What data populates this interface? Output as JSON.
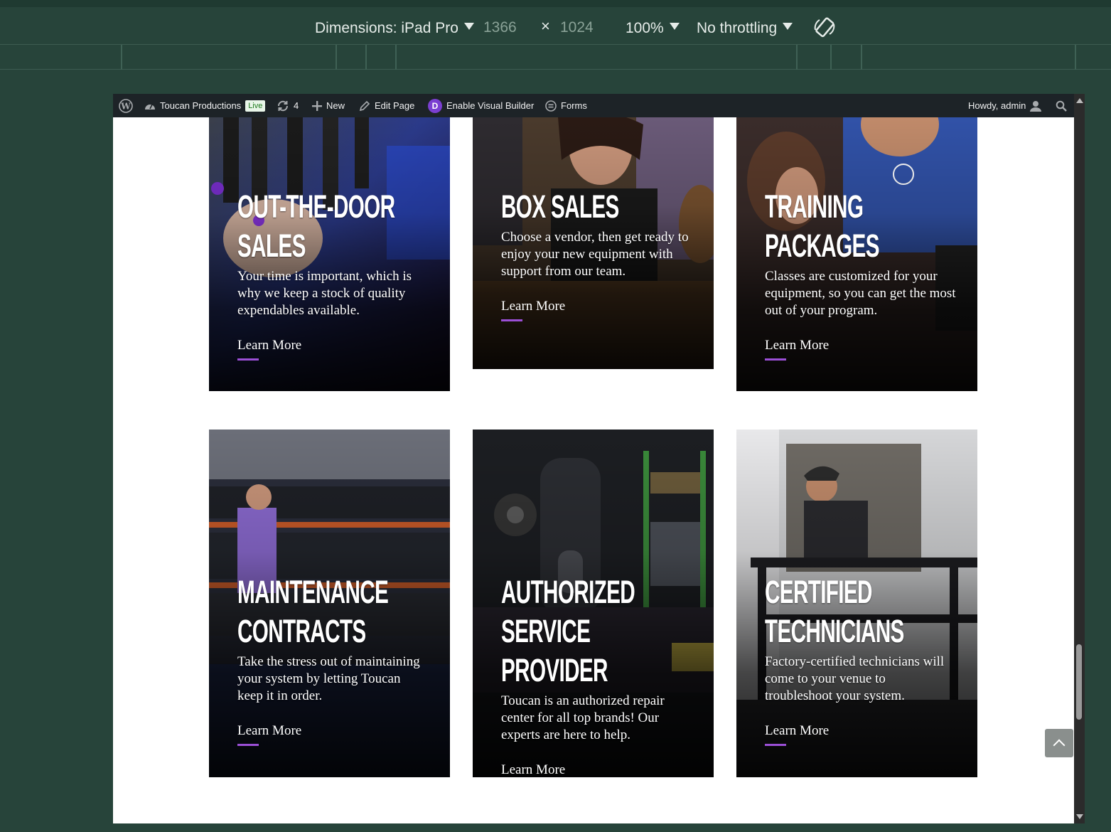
{
  "devtools": {
    "dimensions_label": "Dimensions: iPad Pro",
    "width": "1366",
    "times": "×",
    "height": "1024",
    "zoom": "100%",
    "throttling": "No throttling"
  },
  "adminbar": {
    "site_name": "Toucan Productions",
    "live_badge": "Live",
    "updates_count": "4",
    "new_label": "New",
    "edit_label": "Edit Page",
    "visual_builder_label": "Enable Visual Builder",
    "divi_letter": "D",
    "forms_label": "Forms",
    "howdy_label": "Howdy, admin"
  },
  "cards": [
    {
      "title": "Out-the-Door Sales",
      "text": "Your time is important, which is why we keep a stock of quality expendables available.",
      "link": "Learn More"
    },
    {
      "title": "Box Sales",
      "text": "Choose a vendor, then get ready to enjoy your new equipment with support from our team.",
      "link": "Learn More"
    },
    {
      "title": "Training Packages",
      "text": "Classes are customized for your equipment, so you can get the most out of your program.",
      "link": "Learn More"
    },
    {
      "title": "Maintenance Contracts",
      "text": "Take the stress out of maintaining your system by letting Toucan keep it in order.",
      "link": "Learn More"
    },
    {
      "title": "Authorized Service Provider",
      "text": "Toucan is an authorized repair center for all top brands! Our experts are here to help.",
      "link": "Learn More"
    },
    {
      "title": "Certified Technicians",
      "text": "Factory-certified technicians will come to your venue to troubleshoot your system.",
      "link": "Learn More"
    }
  ],
  "colors": {
    "accent": "#9b4fd6",
    "devtools_bg": "#27443a",
    "adminbar_bg": "#1d2327"
  }
}
